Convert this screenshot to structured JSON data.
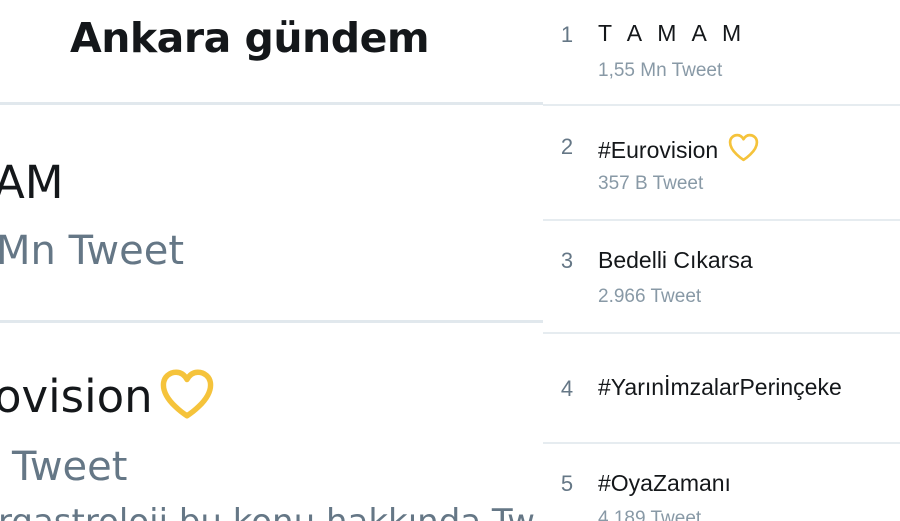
{
  "left_panel": {
    "title": "Ankara gündem",
    "items": [
      {
        "name_fragment": "AM",
        "count_fragment": "Mn Tweet"
      },
      {
        "name_fragment": "ovision",
        "count_fragment": "Tweet",
        "desc_fragment": "rgastroloji bu konu hakkında Tw"
      }
    ]
  },
  "trends": [
    {
      "rank": "1",
      "name": "T A M A M",
      "count": "1,55 Mn Tweet"
    },
    {
      "rank": "2",
      "name": "#Eurovision",
      "count": "357 B Tweet",
      "icon": "heart-icon"
    },
    {
      "rank": "3",
      "name": "Bedelli Cıkarsa",
      "count": "2.966 Tweet"
    },
    {
      "rank": "4",
      "name": "#YarınİmzalarPerinçeke",
      "count": ""
    },
    {
      "rank": "5",
      "name": "#OyaZamanı",
      "count": "4.189 Tweet"
    }
  ],
  "colors": {
    "primary_text": "#14171a",
    "secondary_text": "#657786",
    "divider": "#e1e8ed",
    "heart": "#f5c33b"
  }
}
